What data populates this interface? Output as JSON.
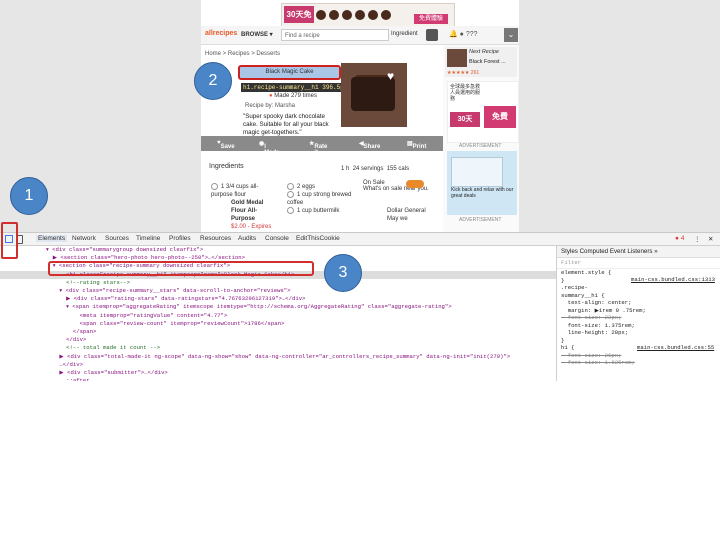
{
  "site": {
    "ad_top": {
      "badge": "30天免費體驗",
      "pink_label": "免費體驗"
    },
    "logo": "allrecipes",
    "browse": "BROWSE ▾",
    "search_placeholder": "Find a recipe",
    "ingredient_btn": "Ingredient",
    "user_count": "???",
    "breadcrumb": {
      "home": "Home",
      "recipes": "Recipes",
      "desserts": "Desserts"
    },
    "recipe_title": "Black Magic Cake",
    "tooltip": "h1.recipe-summary__h1 396.5px × 28px",
    "made_count": "Made 279 times",
    "recipe_by": "Recipe by: Marsha",
    "description": "\"Super spooky dark chocolate cake. Suitable for all your black magic get-togethers.\"",
    "sidebar": {
      "next_label": "Next Recipe",
      "next_name": "Black Forest ...",
      "next_rating": "★★★★★ 261",
      "ad_zh": "全球最多急救人員選用的服務",
      "ad_badge": "30天",
      "ad_pink": "免費",
      "advertisement1": "ADVERTISEMENT",
      "ad_ice_text": "Kick back and relax with our great deals",
      "advertisement2": "ADVERTISEMENT"
    },
    "actions": {
      "save": "Save",
      "made_it": "I Made it",
      "rate_it": "Rate it",
      "share": "Share",
      "print": "Print"
    },
    "ingredients_heading": "Ingredients",
    "stats": {
      "time": "1 h",
      "servings": "24 servings",
      "cals": "155 cals"
    },
    "ingredients_left": [
      "1 3/4 cups all-purpose flour",
      "Gold Medal Flour All-Purpose",
      "$2.00 - Expires in 2"
    ],
    "ingredients_right": [
      "2 eggs",
      "1 cup strong brewed coffee",
      "1 cup buttermilk"
    ],
    "on_sale": "On Sale",
    "on_sale_sub": "What's on sale near you.",
    "dollar_general": "Dollar General",
    "may_we": "May we"
  },
  "devtools": {
    "tabs": [
      "Elements",
      "Network",
      "Sources",
      "Timeline",
      "Profiles",
      "Resources",
      "Audits",
      "Console",
      "EditThisCookie"
    ],
    "error_count": "4",
    "styles_tabs": "Styles   Computed   Event Listeners  »",
    "filter_placeholder": "Filter",
    "code_lines": [
      "▾ <div class=\"summarygroup downsized clearfix\">",
      "  ▶ <section class=\"hero-photo hero-photo--250\">…</section>",
      "  ▾ <section class=\"recipe-summary downsized clearfix\">",
      "      <h1 class=\"recipe-summary__h1\" itemprop=\"name\">Black Magic Cake</h1>",
      "      <!--rating stars-->",
      "    ▾ <div class=\"recipe-summary__stars\" data-scroll-to-anchor=\"reviews\">",
      "      ▶ <div class=\"rating-stars\" data-ratingstars=\"4.76763296127319\">…</div>",
      "      ▾ <span itemprop=\"aggregateRating\" itemscope itemtype=\"http://schema.org/AggregateRating\" class=\"aggregate-rating\">",
      "          <meta itemprop=\"ratingValue\" content=\"4.77\">",
      "          <span class=\"review-count\" itemprop=\"reviewCount\">1786</span>",
      "        </span>",
      "      </div>",
      "      <!-- total made it count -->",
      "    ▶ <div class=\"total-made-it ng-scope\" data-ng-show=\"show\" data-ng-controller=\"ar_controllers_recipe_summary\" data-ng-init=\"init(279)\">",
      "    …</div>",
      "    ▶ <div class=\"submitter\">…</div>",
      "      ::after",
      "    </section>"
    ],
    "styles": [
      "element.style {",
      "}",
      ".recipe-",
      "summary__h1 {",
      "  text-align: center;",
      "  margin: ▶1rem 0 .75rem;",
      "  font-size: 22px;",
      "  font-size: 1.375rem;",
      "  line-height: 28px;",
      "}",
      "h1 {",
      "  font-size: 26px;",
      "  font-size: 1.625rem;"
    ],
    "style_src1": "main-css.bundled.css:1313",
    "style_src2": "main-css.bundled.css:55"
  },
  "callouts": [
    "1",
    "2",
    "3"
  ]
}
